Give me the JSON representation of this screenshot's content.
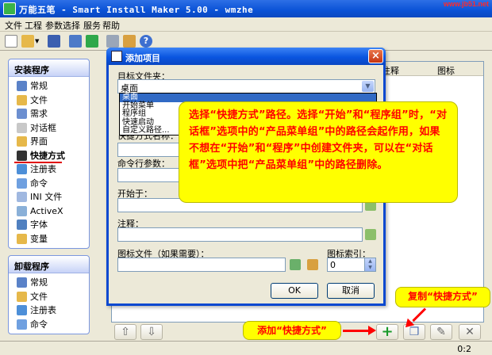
{
  "window": {
    "title": "万能五笔 - Smart Install Maker 5.00 - wmzhe",
    "watermark": "www.jb51.net"
  },
  "menu": [
    "文件",
    "工程",
    "参数选择",
    "服务",
    "帮助"
  ],
  "install_panel": {
    "title": "安装程序",
    "items": [
      {
        "label": "常规",
        "icon": "settings-icon",
        "color": "#5a82c8"
      },
      {
        "label": "文件",
        "icon": "folder-icon",
        "color": "#e6b84a"
      },
      {
        "label": "需求",
        "icon": "document-icon",
        "color": "#6c8fd0"
      },
      {
        "label": "对话框",
        "icon": "dialog-icon",
        "color": "#c8c8c8"
      },
      {
        "label": "界面",
        "icon": "window-icon",
        "color": "#e6b84a"
      },
      {
        "label": "快捷方式",
        "icon": "shortcut-icon",
        "color": "#333333",
        "active": true
      },
      {
        "label": "注册表",
        "icon": "registry-icon",
        "color": "#4d8fd8"
      },
      {
        "label": "命令",
        "icon": "command-icon",
        "color": "#6fa0e0"
      },
      {
        "label": "INI 文件",
        "icon": "ini-file-icon",
        "color": "#a0b8e0"
      },
      {
        "label": "ActiveX",
        "icon": "activex-icon",
        "color": "#8ab0d8"
      },
      {
        "label": "字体",
        "icon": "font-icon",
        "color": "#5080c0"
      },
      {
        "label": "变量",
        "icon": "variable-icon",
        "color": "#e6b84a"
      }
    ]
  },
  "uninstall_panel": {
    "title": "卸载程序",
    "items": [
      {
        "label": "常规",
        "icon": "settings-icon",
        "color": "#5a82c8"
      },
      {
        "label": "文件",
        "icon": "folder-icon",
        "color": "#e6b84a"
      },
      {
        "label": "注册表",
        "icon": "registry-icon",
        "color": "#4d8fd8"
      },
      {
        "label": "命令",
        "icon": "command-icon",
        "color": "#6fa0e0"
      }
    ]
  },
  "list_columns": {
    "comment": "注释",
    "icon": "图标"
  },
  "status": {
    "position": "0:2"
  },
  "dialog": {
    "title": "添加项目",
    "folder_label": "目标文件夹：",
    "folder_value": "桌面",
    "folder_options": [
      "桌面",
      "开始菜单",
      "程序组",
      "快速启动",
      "自定义路径..."
    ],
    "name_label": "快捷方式名称：",
    "cmdline_label": "命令行参数：",
    "startin_label": "开始于：",
    "comment_label": "注释：",
    "iconfile_label": "图标文件（如果需要）：",
    "iconindex_label": "图标索引：",
    "iconindex_value": "0",
    "ok": "OK",
    "cancel": "取消"
  },
  "callout": {
    "text": "选择“快捷方式”路径。选择“开始”和“程序组”时，“对话框”选项中的“产品菜单组”中的路径会起作用，如果不想在“开始”和“程序”中创建文件夹，可以在“对话框”选项中把“产品菜单组”中的路径删除。"
  },
  "tags": {
    "add": "添加“快捷方式”",
    "copy": "复制“快捷方式”"
  },
  "colors": {
    "accent": "#0a52d6",
    "callout_bg": "#ffff00",
    "callout_text": "#ff0000"
  }
}
